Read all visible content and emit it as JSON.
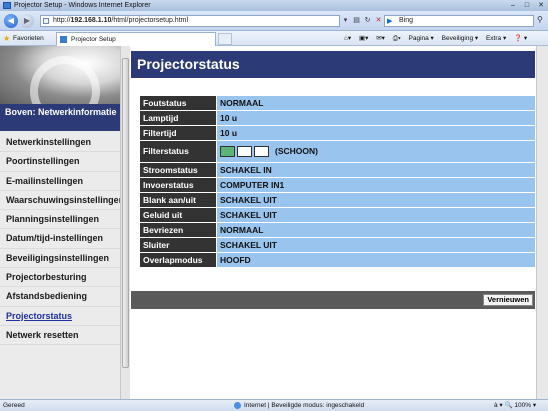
{
  "window": {
    "title": "Projector Setup - Windows Internet Explorer",
    "controls": [
      "–",
      "□",
      "✕"
    ]
  },
  "address": {
    "url_prefix": "http://",
    "url_host": "192.168.1.10",
    "url_path": "/html/projectorsetup.html",
    "search_placeholder": "Bing"
  },
  "favbar": {
    "favorites_label": "Favorieten",
    "tab_title": "Projector Setup",
    "commands": [
      "Pagina ▾",
      "Beveiliging ▾",
      "Extra ▾",
      "❓ ▾"
    ]
  },
  "sidebar": {
    "header": "Boven: Netwerkinformatie",
    "items": [
      {
        "label": "Netwerkinstellingen",
        "active": false
      },
      {
        "label": "Poortinstellingen",
        "active": false
      },
      {
        "label": "E-mailinstellingen",
        "active": false
      },
      {
        "label": "Waarschuwingsinstellingen",
        "active": false
      },
      {
        "label": "Planningsinstellingen",
        "active": false
      },
      {
        "label": "Datum/tijd-instellingen",
        "active": false
      },
      {
        "label": "Beveiligingsinstellingen",
        "active": false
      },
      {
        "label": "Projectorbesturing",
        "active": false
      },
      {
        "label": "Afstandsbediening",
        "active": false
      },
      {
        "label": "Projectorstatus",
        "active": true
      },
      {
        "label": "Netwerk resetten",
        "active": false
      }
    ]
  },
  "main": {
    "title": "Projectorstatus",
    "rows": [
      {
        "label": "Foutstatus",
        "value": "NORMAAL"
      },
      {
        "label": "Lamptijd",
        "value": "10 u"
      },
      {
        "label": "Filtertijd",
        "value": "10 u"
      },
      {
        "label": "Filterstatus",
        "value": "(SCHOON)",
        "filter_boxes": [
          "green",
          "white",
          "white"
        ]
      },
      {
        "label": "Stroomstatus",
        "value": "SCHAKEL IN"
      },
      {
        "label": "Invoerstatus",
        "value": "COMPUTER IN1"
      },
      {
        "label": "Blank aan/uit",
        "value": "SCHAKEL UIT"
      },
      {
        "label": "Geluid uit",
        "value": "SCHAKEL UIT"
      },
      {
        "label": "Bevriezen",
        "value": "NORMAAL"
      },
      {
        "label": "Sluiter",
        "value": "SCHAKEL UIT"
      },
      {
        "label": "Overlapmodus",
        "value": "HOOFD"
      }
    ],
    "refresh_label": "Vernieuwen"
  },
  "statusbar": {
    "left": "Gereed",
    "middle": "Internet | Beveiligde modus: ingeschakeld",
    "zoom": "à ▾  🔍 100% ▾"
  },
  "colors": {
    "header_navy": "#2d3a78",
    "label_bg": "#333333",
    "value_bg": "#99c4ee",
    "filter_green": "#5cb47a"
  }
}
